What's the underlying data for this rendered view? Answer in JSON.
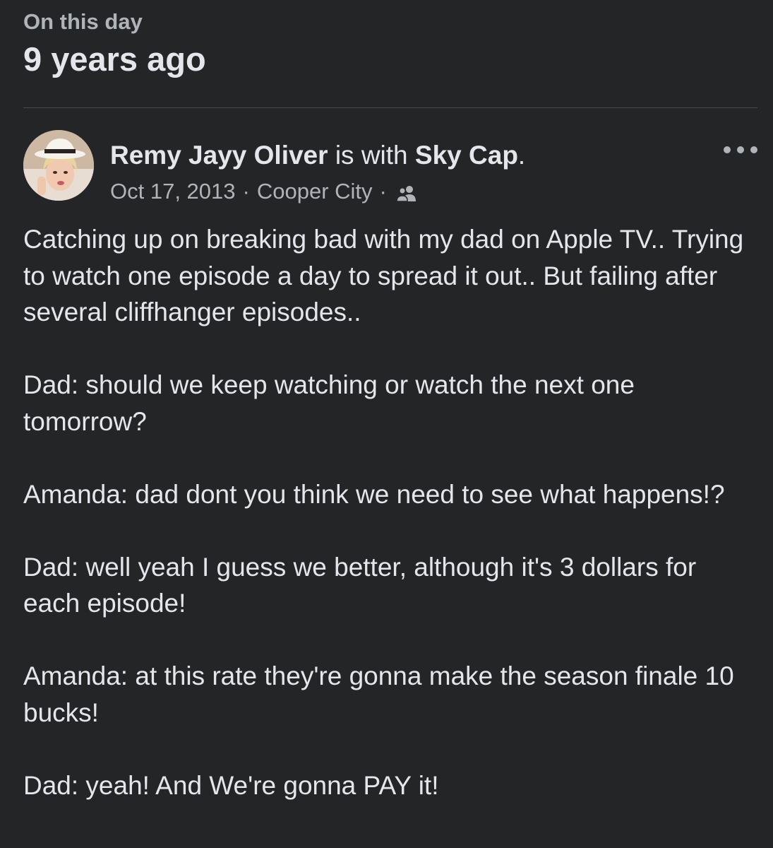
{
  "memory": {
    "label": "On this day",
    "title": "9 years ago"
  },
  "post": {
    "author": "Remy Jayy Oliver",
    "with_text": " is with ",
    "tagged": "Sky Cap",
    "tagged_suffix": ".",
    "date": "Oct 17, 2013",
    "separator": "·",
    "location": "Cooper City",
    "audience_icon": "friends-icon",
    "more_icon": "more-options-icon",
    "paragraphs": [
      "Catching up on breaking bad with my dad on Apple TV.. Trying to watch one episode a day to spread it out.. But failing after several cliffhanger episodes..",
      "Dad: should we keep watching or watch the next one tomorrow?",
      "Amanda: dad dont you think we need to see what happens!?",
      "Dad: well yeah I guess we better, although it's 3 dollars for each episode!",
      "Amanda: at this rate they're gonna make the season finale 10 bucks!",
      "Dad: yeah! And We're gonna PAY it!"
    ]
  },
  "colors": {
    "background": "#242526",
    "primary_text": "#e4e6eb",
    "secondary_text": "#b0b3b8",
    "divider": "#4a4b4d"
  }
}
